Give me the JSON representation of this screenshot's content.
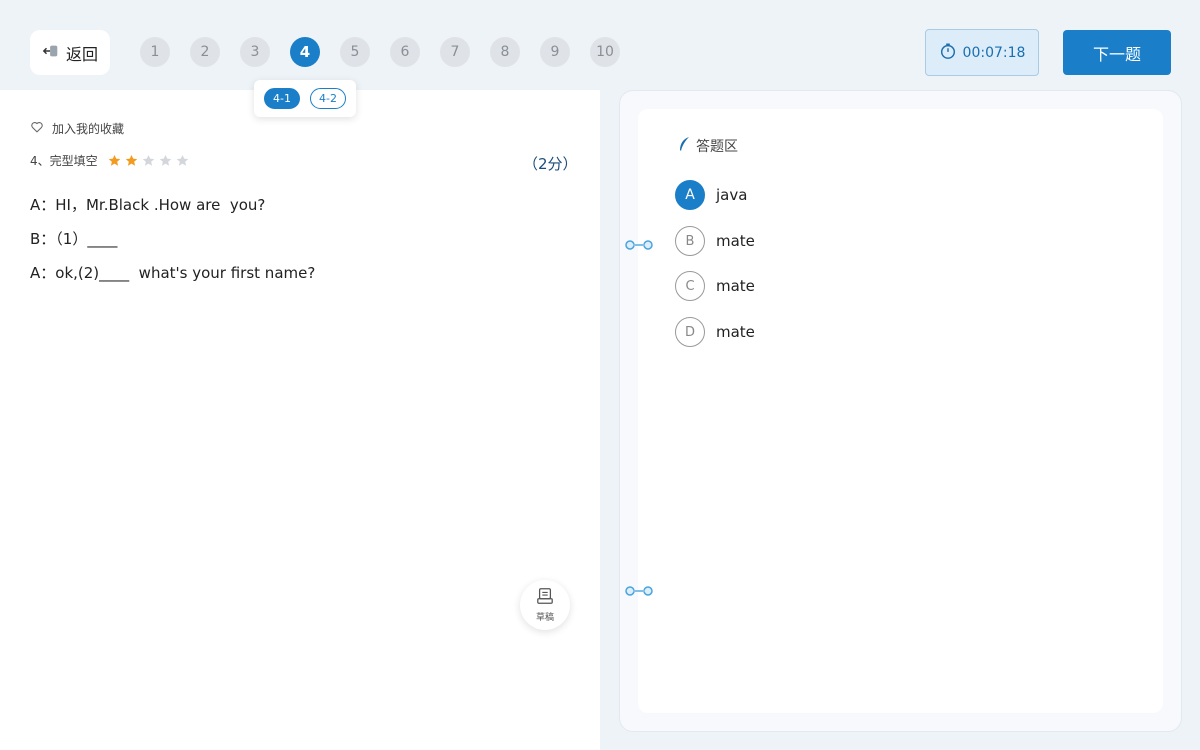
{
  "header": {
    "back_label": "返回",
    "question_numbers": [
      "1",
      "2",
      "3",
      "4",
      "5",
      "6",
      "7",
      "8",
      "9",
      "10"
    ],
    "active_question": "4",
    "sub_questions": [
      "4-1",
      "4-2"
    ],
    "active_sub": "4-1",
    "timer": "00:07:18",
    "next_label": "下一题"
  },
  "question": {
    "favorite_label": "加入我的收藏",
    "type_label": "4、完型填空",
    "difficulty": 2,
    "difficulty_max": 5,
    "score": "（2分）",
    "lines": [
      "A：HI，Mr.Black .How are  you?",
      "B：（1）____",
      "A：ok,(2)____  what's your first name?"
    ],
    "draft_label": "草稿"
  },
  "answer": {
    "title": "答题区",
    "options": [
      {
        "letter": "A",
        "text": "java",
        "selected": true
      },
      {
        "letter": "B",
        "text": "mate",
        "selected": false
      },
      {
        "letter": "C",
        "text": "mate",
        "selected": false
      },
      {
        "letter": "D",
        "text": "mate",
        "selected": false
      }
    ]
  },
  "colors": {
    "accent": "#1a7fc8",
    "star_on": "#f29b1f",
    "star_off": "#d3d6da"
  }
}
